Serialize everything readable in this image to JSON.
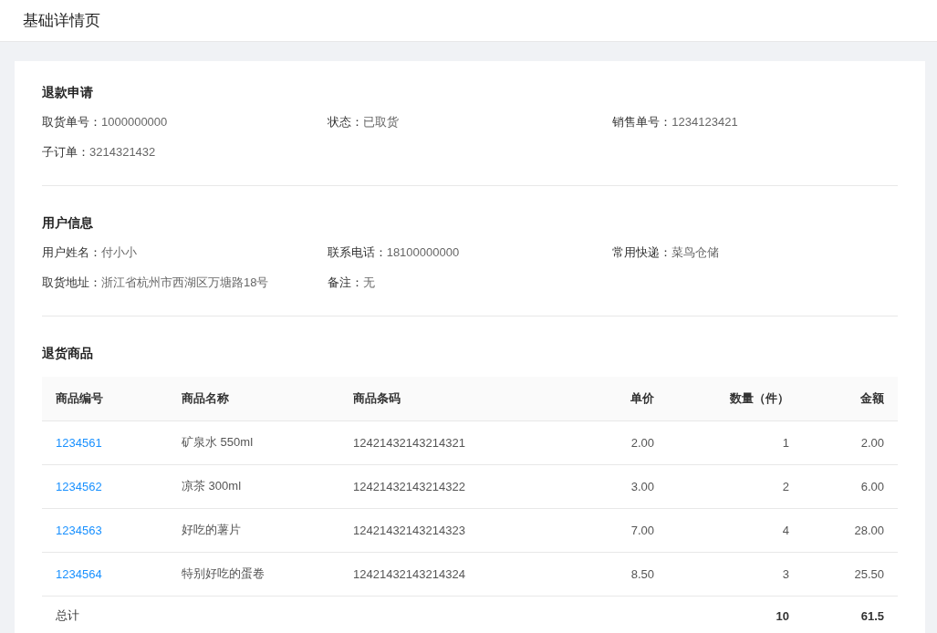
{
  "page": {
    "title": "基础详情页"
  },
  "sections": [
    {
      "title": "退款申请",
      "items": [
        {
          "label": "取货单号：",
          "value": "1000000000"
        },
        {
          "label": "状态：",
          "value": "已取货"
        },
        {
          "label": "销售单号：",
          "value": "1234123421"
        },
        {
          "label": "子订单：",
          "value": "3214321432"
        }
      ]
    },
    {
      "title": "用户信息",
      "items": [
        {
          "label": "用户姓名：",
          "value": "付小小"
        },
        {
          "label": "联系电话：",
          "value": "18100000000"
        },
        {
          "label": "常用快递：",
          "value": "菜鸟仓储"
        },
        {
          "label": "取货地址：",
          "value": "浙江省杭州市西湖区万塘路18号"
        },
        {
          "label": "备注：",
          "value": "无"
        }
      ]
    }
  ],
  "goods": {
    "title": "退货商品",
    "columns": [
      {
        "label": "商品编号",
        "kind": "link"
      },
      {
        "label": "商品名称",
        "kind": "text"
      },
      {
        "label": "商品条码",
        "kind": "text"
      },
      {
        "label": "单价",
        "kind": "number"
      },
      {
        "label": "数量（件）",
        "kind": "number"
      },
      {
        "label": "金额",
        "kind": "number"
      }
    ],
    "rows": [
      [
        "1234561",
        "矿泉水 550ml",
        "12421432143214321",
        "2.00",
        "1",
        "2.00"
      ],
      [
        "1234562",
        "凉茶 300ml",
        "12421432143214322",
        "3.00",
        "2",
        "6.00"
      ],
      [
        "1234563",
        "好吃的薯片",
        "12421432143214323",
        "7.00",
        "4",
        "28.00"
      ],
      [
        "1234564",
        "特别好吃的蛋卷",
        "12421432143214324",
        "8.50",
        "3",
        "25.50"
      ]
    ],
    "total": {
      "label": "总计",
      "quantity": "10",
      "amount": "61.5"
    }
  }
}
